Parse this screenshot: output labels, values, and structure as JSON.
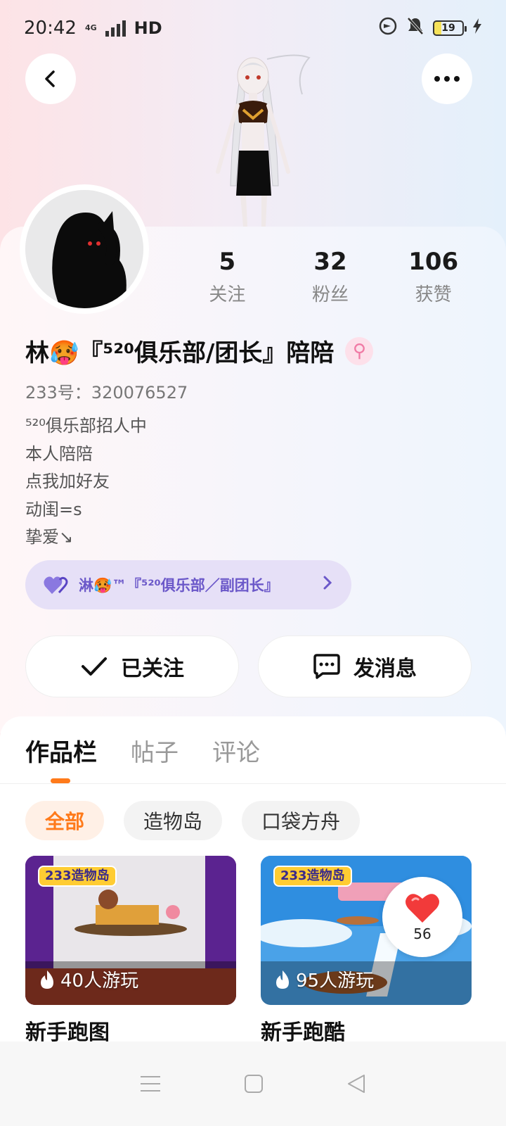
{
  "status_bar": {
    "time": "20:42",
    "network": "4G",
    "hd": "HD",
    "battery": "19"
  },
  "profile": {
    "name": "林🥵『⁵²⁰俱乐部/团长』陪陪",
    "gender_symbol": "⚲",
    "uid_label": "233号：320076527",
    "bio_lines": [
      "⁵²⁰俱乐部招人中",
      "本人陪陪",
      "点我加好友",
      "动闺=s",
      "挚爱↘"
    ],
    "stats": [
      {
        "value": "5",
        "label": "关注"
      },
      {
        "value": "32",
        "label": "粉丝"
      },
      {
        "value": "106",
        "label": "获赞"
      }
    ],
    "relation": {
      "text": "淋🥵™『⁵²⁰俱乐部／副团长』",
      "heart_color": "#7b6ad8"
    }
  },
  "actions": {
    "follow_label": "已关注",
    "message_label": "发消息"
  },
  "tabs": [
    "作品栏",
    "帖子",
    "评论"
  ],
  "filters": [
    "全部",
    "造物岛",
    "口袋方舟"
  ],
  "works": [
    {
      "title": "新手跑图",
      "plays": "40人游玩",
      "badge": "233造物岛"
    },
    {
      "title": "新手跑酷",
      "plays": "95人游玩",
      "badge": "233造物岛"
    }
  ],
  "like_bubble": {
    "count": "56"
  },
  "colors": {
    "accent": "#ff7a1a",
    "relation_bg": "#e6e0f7",
    "relation_text": "#6b58c9"
  }
}
